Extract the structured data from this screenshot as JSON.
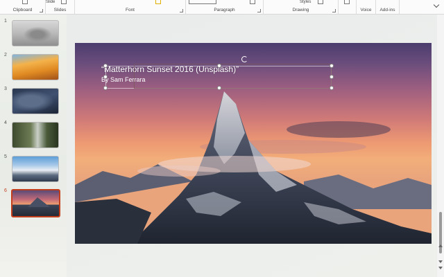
{
  "ribbon": {
    "groups": [
      {
        "label": "Clipboard"
      },
      {
        "label": "Slides",
        "top_label": "Slide"
      },
      {
        "label": "Font"
      },
      {
        "label": "Paragraph"
      },
      {
        "label": "Drawing",
        "top_label": "Styles"
      },
      {
        "label": "Voice"
      },
      {
        "label": "Add-ins"
      }
    ]
  },
  "thumbnails": [
    {
      "num": "1"
    },
    {
      "num": "2"
    },
    {
      "num": "3"
    },
    {
      "num": "4"
    },
    {
      "num": "5"
    },
    {
      "num": "6"
    }
  ],
  "slide": {
    "title": "“Matterhorn Sunset 2016 (Unsplash)”",
    "subtitle": "By Sam Ferrara"
  },
  "colors": {
    "accent": "#c43e1c"
  }
}
